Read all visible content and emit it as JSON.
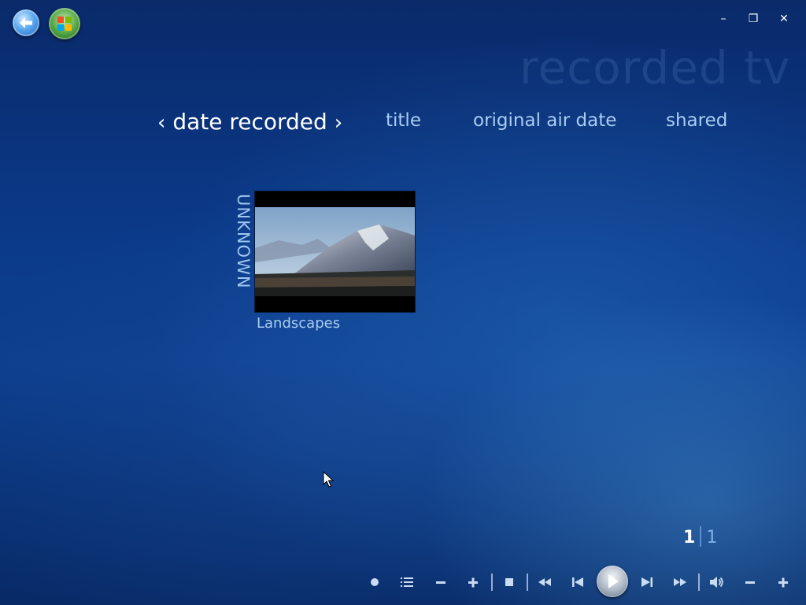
{
  "window": {
    "minimize_label": "–",
    "restore_label": "❐",
    "close_label": "✕"
  },
  "watermark": "recorded tv",
  "pivot": {
    "active": "date recorded",
    "prev_chevron": "‹",
    "next_chevron": "›",
    "items": [
      "title",
      "original air date",
      "shared"
    ]
  },
  "group": {
    "label": "UNKNOWN",
    "items": [
      {
        "title": "Landscapes"
      }
    ]
  },
  "pagination": {
    "current": "1",
    "total": "1"
  },
  "transport": {
    "buttons": [
      "record",
      "guide",
      "channel-down",
      "channel-up",
      "stop",
      "rewind",
      "skip-back",
      "play",
      "skip-forward",
      "fast-forward",
      "mute",
      "volume-down",
      "volume-up"
    ]
  },
  "colors": {
    "background": "#0b3a8a",
    "active_text": "#ffffff",
    "inactive_text": "#a9cdf2"
  }
}
